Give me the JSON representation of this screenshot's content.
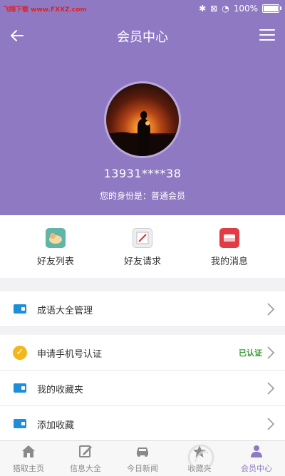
{
  "status_bar": {
    "watermark": "飞翔下载 www.FXXZ.com",
    "battery": "100%"
  },
  "nav": {
    "title": "会员中心"
  },
  "profile": {
    "phone": "13931****38",
    "identity": "您的身份是：普通会员"
  },
  "shortcuts": [
    {
      "label": "好友列表",
      "icon": "friends-list-icon"
    },
    {
      "label": "好友请求",
      "icon": "friend-request-icon"
    },
    {
      "label": "我的消息",
      "icon": "messages-icon"
    }
  ],
  "menu": {
    "idiom_manage": "成语大全管理",
    "phone_verify": "申请手机号认证",
    "phone_verify_status": "已认证",
    "my_favorites": "我的收藏夹",
    "add_favorite": "添加收藏"
  },
  "tabs": [
    {
      "label": "猎取主页",
      "icon": "home-icon"
    },
    {
      "label": "信息大全",
      "icon": "edit-icon"
    },
    {
      "label": "今日新闻",
      "icon": "car-icon"
    },
    {
      "label": "收藏夹",
      "icon": "star-icon"
    },
    {
      "label": "会员中心",
      "icon": "user-icon"
    }
  ],
  "colors": {
    "header": "#9079c3",
    "accent_blue": "#1f8ed8",
    "verified_green": "#3a9c3a",
    "check_yellow": "#f2b81b"
  }
}
